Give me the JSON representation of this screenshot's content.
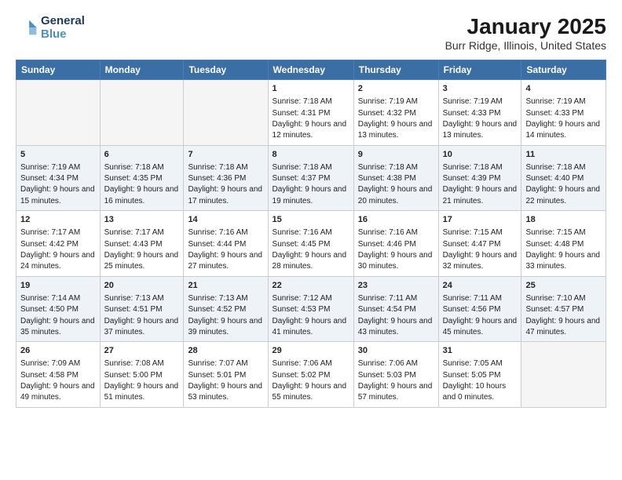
{
  "header": {
    "logo_line1": "General",
    "logo_line2": "Blue",
    "title": "January 2025",
    "subtitle": "Burr Ridge, Illinois, United States"
  },
  "weekdays": [
    "Sunday",
    "Monday",
    "Tuesday",
    "Wednesday",
    "Thursday",
    "Friday",
    "Saturday"
  ],
  "weeks": [
    [
      {
        "day": "",
        "empty": true
      },
      {
        "day": "",
        "empty": true
      },
      {
        "day": "",
        "empty": true
      },
      {
        "day": "1",
        "sunrise": "7:18 AM",
        "sunset": "4:31 PM",
        "daylight": "9 hours and 12 minutes."
      },
      {
        "day": "2",
        "sunrise": "7:19 AM",
        "sunset": "4:32 PM",
        "daylight": "9 hours and 13 minutes."
      },
      {
        "day": "3",
        "sunrise": "7:19 AM",
        "sunset": "4:33 PM",
        "daylight": "9 hours and 13 minutes."
      },
      {
        "day": "4",
        "sunrise": "7:19 AM",
        "sunset": "4:33 PM",
        "daylight": "9 hours and 14 minutes."
      }
    ],
    [
      {
        "day": "5",
        "sunrise": "7:19 AM",
        "sunset": "4:34 PM",
        "daylight": "9 hours and 15 minutes."
      },
      {
        "day": "6",
        "sunrise": "7:18 AM",
        "sunset": "4:35 PM",
        "daylight": "9 hours and 16 minutes."
      },
      {
        "day": "7",
        "sunrise": "7:18 AM",
        "sunset": "4:36 PM",
        "daylight": "9 hours and 17 minutes."
      },
      {
        "day": "8",
        "sunrise": "7:18 AM",
        "sunset": "4:37 PM",
        "daylight": "9 hours and 19 minutes."
      },
      {
        "day": "9",
        "sunrise": "7:18 AM",
        "sunset": "4:38 PM",
        "daylight": "9 hours and 20 minutes."
      },
      {
        "day": "10",
        "sunrise": "7:18 AM",
        "sunset": "4:39 PM",
        "daylight": "9 hours and 21 minutes."
      },
      {
        "day": "11",
        "sunrise": "7:18 AM",
        "sunset": "4:40 PM",
        "daylight": "9 hours and 22 minutes."
      }
    ],
    [
      {
        "day": "12",
        "sunrise": "7:17 AM",
        "sunset": "4:42 PM",
        "daylight": "9 hours and 24 minutes."
      },
      {
        "day": "13",
        "sunrise": "7:17 AM",
        "sunset": "4:43 PM",
        "daylight": "9 hours and 25 minutes."
      },
      {
        "day": "14",
        "sunrise": "7:16 AM",
        "sunset": "4:44 PM",
        "daylight": "9 hours and 27 minutes."
      },
      {
        "day": "15",
        "sunrise": "7:16 AM",
        "sunset": "4:45 PM",
        "daylight": "9 hours and 28 minutes."
      },
      {
        "day": "16",
        "sunrise": "7:16 AM",
        "sunset": "4:46 PM",
        "daylight": "9 hours and 30 minutes."
      },
      {
        "day": "17",
        "sunrise": "7:15 AM",
        "sunset": "4:47 PM",
        "daylight": "9 hours and 32 minutes."
      },
      {
        "day": "18",
        "sunrise": "7:15 AM",
        "sunset": "4:48 PM",
        "daylight": "9 hours and 33 minutes."
      }
    ],
    [
      {
        "day": "19",
        "sunrise": "7:14 AM",
        "sunset": "4:50 PM",
        "daylight": "9 hours and 35 minutes."
      },
      {
        "day": "20",
        "sunrise": "7:13 AM",
        "sunset": "4:51 PM",
        "daylight": "9 hours and 37 minutes."
      },
      {
        "day": "21",
        "sunrise": "7:13 AM",
        "sunset": "4:52 PM",
        "daylight": "9 hours and 39 minutes."
      },
      {
        "day": "22",
        "sunrise": "7:12 AM",
        "sunset": "4:53 PM",
        "daylight": "9 hours and 41 minutes."
      },
      {
        "day": "23",
        "sunrise": "7:11 AM",
        "sunset": "4:54 PM",
        "daylight": "9 hours and 43 minutes."
      },
      {
        "day": "24",
        "sunrise": "7:11 AM",
        "sunset": "4:56 PM",
        "daylight": "9 hours and 45 minutes."
      },
      {
        "day": "25",
        "sunrise": "7:10 AM",
        "sunset": "4:57 PM",
        "daylight": "9 hours and 47 minutes."
      }
    ],
    [
      {
        "day": "26",
        "sunrise": "7:09 AM",
        "sunset": "4:58 PM",
        "daylight": "9 hours and 49 minutes."
      },
      {
        "day": "27",
        "sunrise": "7:08 AM",
        "sunset": "5:00 PM",
        "daylight": "9 hours and 51 minutes."
      },
      {
        "day": "28",
        "sunrise": "7:07 AM",
        "sunset": "5:01 PM",
        "daylight": "9 hours and 53 minutes."
      },
      {
        "day": "29",
        "sunrise": "7:06 AM",
        "sunset": "5:02 PM",
        "daylight": "9 hours and 55 minutes."
      },
      {
        "day": "30",
        "sunrise": "7:06 AM",
        "sunset": "5:03 PM",
        "daylight": "9 hours and 57 minutes."
      },
      {
        "day": "31",
        "sunrise": "7:05 AM",
        "sunset": "5:05 PM",
        "daylight": "10 hours and 0 minutes."
      },
      {
        "day": "",
        "empty": true
      }
    ]
  ]
}
